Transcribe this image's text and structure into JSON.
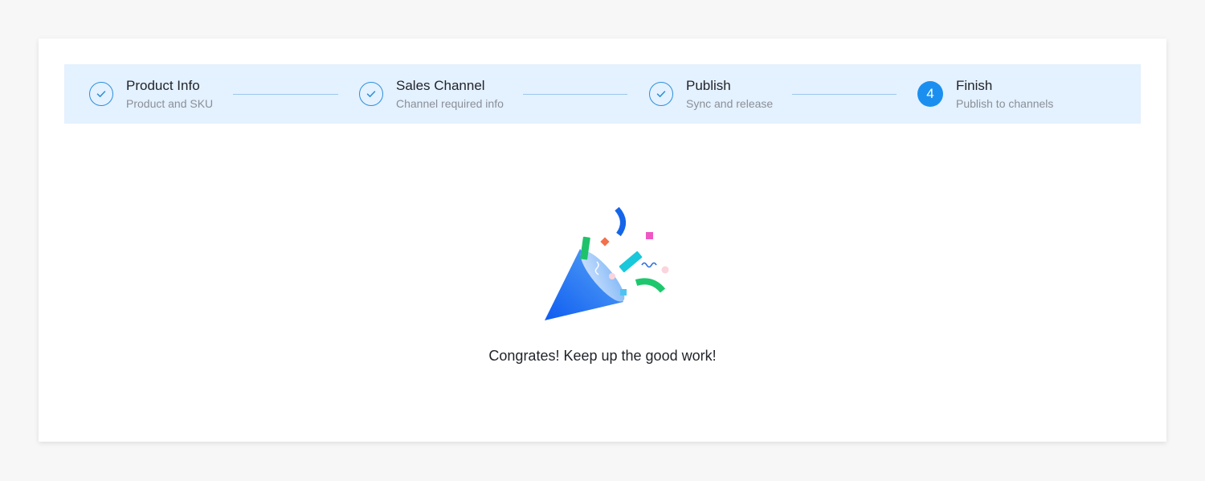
{
  "steps": [
    {
      "title": "Product Info",
      "subtitle": "Product and SKU",
      "state": "done",
      "icon": "check-icon"
    },
    {
      "title": "Sales Channel",
      "subtitle": "Channel required info",
      "state": "done",
      "icon": "check-icon"
    },
    {
      "title": "Publish",
      "subtitle": "Sync and release",
      "state": "done",
      "icon": "check-icon"
    },
    {
      "title": "Finish",
      "subtitle": "Publish to channels",
      "state": "active",
      "number": "4"
    }
  ],
  "result": {
    "message": "Congrates! Keep up the good work!",
    "illustration": "party-popper-icon"
  },
  "colors": {
    "accent": "#1b8ff0",
    "steps_background": "#e4f1fe",
    "connector": "#9cc9ea"
  }
}
